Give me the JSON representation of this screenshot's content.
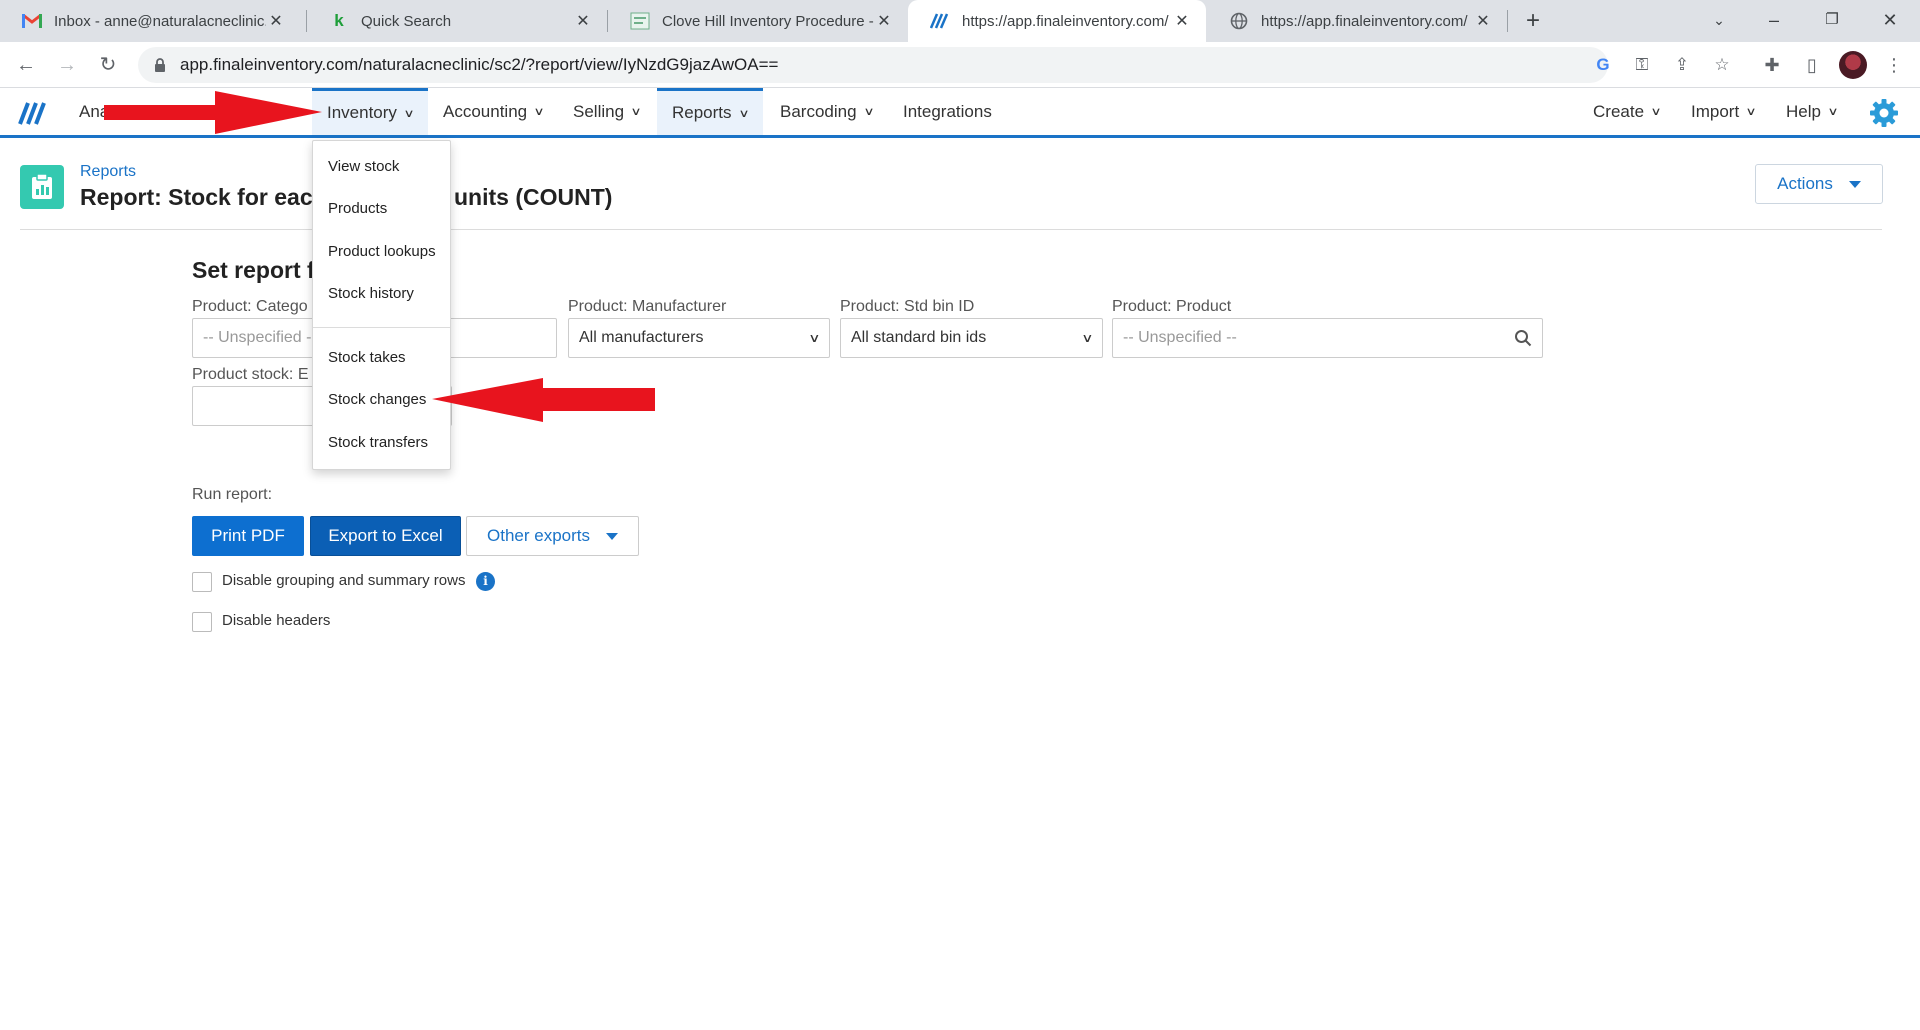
{
  "browser": {
    "tabs": [
      {
        "title": "Inbox - anne@naturalacneclinic.c",
        "favicon": "gmail-icon"
      },
      {
        "title": "Quick Search",
        "favicon": "green-k-icon"
      },
      {
        "title": "Clove Hill Inventory Procedure - ",
        "favicon": "doc-icon"
      },
      {
        "title": "https://app.finaleinventory.com/",
        "favicon": "finale-icon"
      },
      {
        "title": "https://app.finaleinventory.com/",
        "favicon": "globe-icon"
      }
    ],
    "url": "app.finaleinventory.com/naturalacneclinic/sc2/?report/view/IyNzdG9jazAwOA=="
  },
  "appnav": {
    "items": [
      {
        "label": "Ana"
      },
      {
        "label": "Inventory"
      },
      {
        "label": "Accounting"
      },
      {
        "label": "Selling"
      },
      {
        "label": "Reports"
      },
      {
        "label": "Barcoding"
      },
      {
        "label": "Integrations"
      }
    ],
    "right": [
      {
        "label": "Create"
      },
      {
        "label": "Import"
      },
      {
        "label": "Help"
      }
    ]
  },
  "inventory_menu": {
    "items": [
      "View stock",
      "Products",
      "Product lookups",
      "Stock history",
      "Stock takes",
      "Stock changes",
      "Stock transfers"
    ]
  },
  "header": {
    "breadcrumb": "Reports",
    "title_left": "Report: Stock for eacl",
    "title_right": "units (COUNT)",
    "actions_label": "Actions"
  },
  "filters": {
    "section_title": "Set report f",
    "category": {
      "label": "Product: Catego",
      "placeholder": "-- Unspecified -"
    },
    "manufacturer": {
      "label": "Product: Manufacturer",
      "value": "All manufacturers"
    },
    "bin": {
      "label": "Product: Std bin ID",
      "value": "All standard bin ids"
    },
    "product": {
      "label": "Product: Product",
      "placeholder": "-- Unspecified --"
    },
    "stock": {
      "label": "Product stock: E"
    }
  },
  "run": {
    "label": "Run report:",
    "print_pdf": "Print PDF",
    "export_excel": "Export to Excel",
    "other_exports": "Other exports",
    "disable_grouping": "Disable grouping and summary rows",
    "disable_headers": "Disable headers"
  },
  "colors": {
    "accent": "#1a73c7",
    "primary_button": "#0d6fd0",
    "report_icon": "#34c9b0",
    "arrow": "#e8141e"
  }
}
